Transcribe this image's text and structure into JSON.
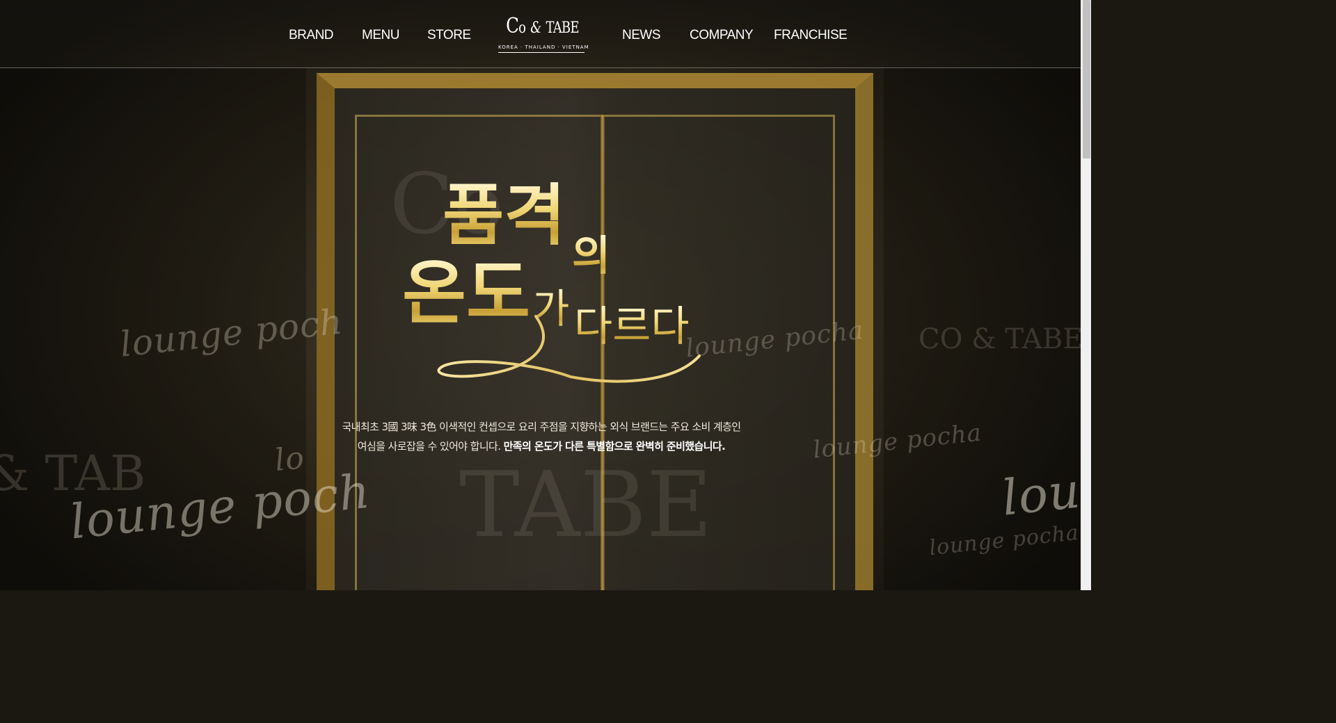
{
  "nav": {
    "left": [
      "BRAND",
      "MENU",
      "STORE"
    ],
    "right": [
      "NEWS",
      "COMPANY",
      "FRANCHISE"
    ]
  },
  "logo": {
    "main_c": "C",
    "main_o": "o",
    "main_amp": "&",
    "main_tabe": "TABE",
    "sub": "KOREA · THAILAND · VIETNAM"
  },
  "hero": {
    "headline_line1": "품격",
    "headline_line1_end": "의",
    "headline_line2": "온도",
    "headline_line2_mid": "가",
    "headline_line2_end": "다르다",
    "desc_line1": "국내최초 3國 3味 3色 이색적인 컨셉으로 요리 주점을 지향하는 외식 브랜드는 주요 소비 계층인",
    "desc_line2_normal": "여심을 사로잡을 수 있어야 합니다. ",
    "desc_line2_bold": "만족의 온도가 다른 특별함으로 완벽히 준비했습니다."
  },
  "background_text": {
    "script": "lounge pocha",
    "script_short": "lounge poch",
    "script_frag": "lo",
    "script_frag2": "lou",
    "brand": "CO & TABE",
    "brand_frag": "& TAB",
    "brand_big": "TABE",
    "brand_co": "Co"
  },
  "colors": {
    "gold": "#e6c766",
    "text": "#efe9dc"
  }
}
